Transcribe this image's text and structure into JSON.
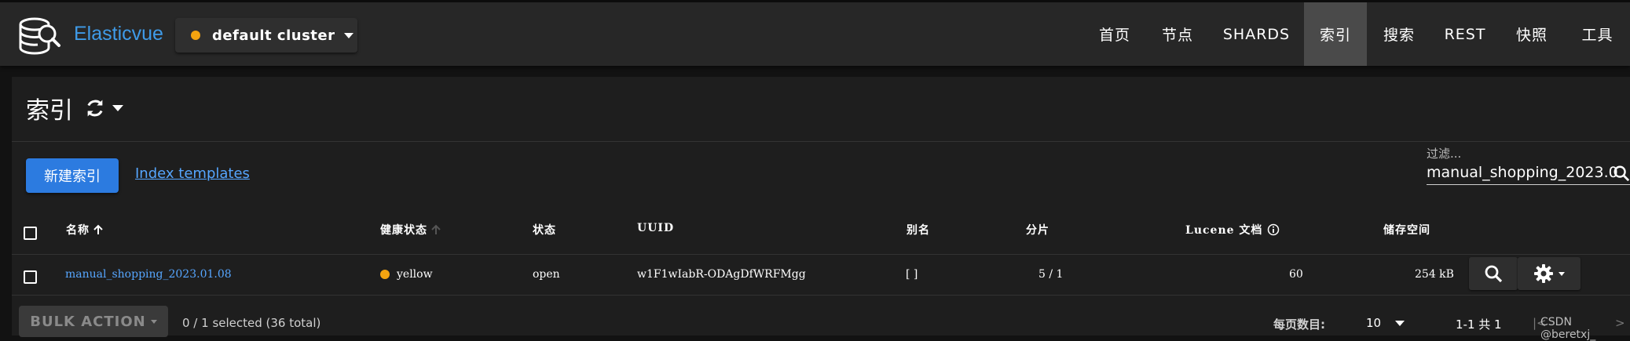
{
  "app": {
    "brand": "Elasticvue",
    "cluster_name": "default cluster",
    "cluster_status_color": "#f4a410"
  },
  "nav": {
    "items": [
      {
        "label": "首页"
      },
      {
        "label": "节点"
      },
      {
        "label": "SHARDS"
      },
      {
        "label": "索引",
        "active": true
      },
      {
        "label": "搜索"
      },
      {
        "label": "REST"
      },
      {
        "label": "快照"
      },
      {
        "label": "工具"
      }
    ]
  },
  "page": {
    "title": "索引",
    "new_index_label": "新建索引",
    "templates_link": "Index templates",
    "filter_label": "过滤...",
    "filter_value": "manual_shopping_2023.0"
  },
  "table": {
    "headers": {
      "name": "名称",
      "health": "健康状态",
      "status": "状态",
      "uuid": "UUID",
      "aliases": "别名",
      "shards": "分片",
      "docs": "Lucene 文档",
      "storage": "储存空间"
    },
    "rows": [
      {
        "name": "manual_shopping_2023.01.08",
        "health": "yellow",
        "health_color": "#f4a410",
        "status": "open",
        "uuid": "w1F1wIabR-ODAgDfWRFMgg",
        "aliases": "[ ]",
        "shards": "5 / 1",
        "docs": "60",
        "storage": "254 kB"
      }
    ]
  },
  "footer": {
    "bulk_action": "BULK ACTION",
    "selection": "0 / 1 selected (36 total)",
    "per_page_label": "每页数目:",
    "per_page_value": "10",
    "range": "1-1 共 1",
    "watermark": "CSDN @beretxj_"
  },
  "colors": {
    "accent": "#2c7be0",
    "link": "#56a6ff",
    "warning": "#f4a410"
  }
}
